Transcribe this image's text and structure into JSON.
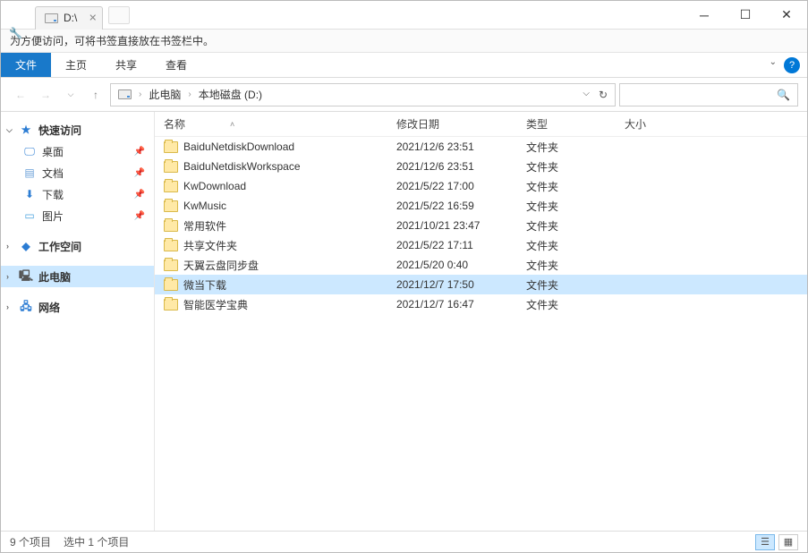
{
  "tab": {
    "title": "D:\\"
  },
  "bookmark_hint": "为方便访问，可将书签直接放在书签栏中。",
  "ribbon": {
    "file": "文件",
    "home": "主页",
    "share": "共享",
    "view": "查看"
  },
  "breadcrumb": {
    "root": "此电脑",
    "current": "本地磁盘 (D:)"
  },
  "columns": {
    "name": "名称",
    "date": "修改日期",
    "type": "类型",
    "size": "大小"
  },
  "sidebar": {
    "quick_access": "快速访问",
    "desktop": "桌面",
    "documents": "文档",
    "downloads": "下载",
    "pictures": "图片",
    "workspace": "工作空间",
    "this_pc": "此电脑",
    "network": "网络"
  },
  "files": [
    {
      "name": "BaiduNetdiskDownload",
      "date": "2021/12/6 23:51",
      "type": "文件夹"
    },
    {
      "name": "BaiduNetdiskWorkspace",
      "date": "2021/12/6 23:51",
      "type": "文件夹"
    },
    {
      "name": "KwDownload",
      "date": "2021/5/22 17:00",
      "type": "文件夹"
    },
    {
      "name": "KwMusic",
      "date": "2021/5/22 16:59",
      "type": "文件夹"
    },
    {
      "name": "常用软件",
      "date": "2021/10/21 23:47",
      "type": "文件夹"
    },
    {
      "name": "共享文件夹",
      "date": "2021/5/22 17:11",
      "type": "文件夹"
    },
    {
      "name": "天翼云盘同步盘",
      "date": "2021/5/20 0:40",
      "type": "文件夹"
    },
    {
      "name": "微当下载",
      "date": "2021/12/7 17:50",
      "type": "文件夹",
      "selected": true
    },
    {
      "name": "智能医学宝典",
      "date": "2021/12/7 16:47",
      "type": "文件夹"
    }
  ],
  "status": {
    "count": "9 个项目",
    "selected": "选中 1 个项目"
  }
}
